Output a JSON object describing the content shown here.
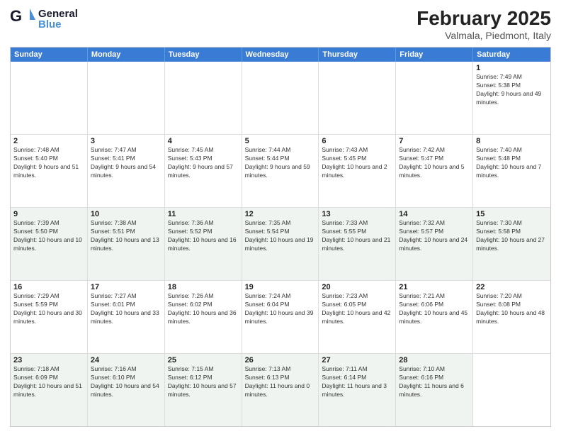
{
  "header": {
    "logo_line1": "General",
    "logo_line2": "Blue",
    "month_title": "February 2025",
    "subtitle": "Valmala, Piedmont, Italy"
  },
  "calendar": {
    "days_of_week": [
      "Sunday",
      "Monday",
      "Tuesday",
      "Wednesday",
      "Thursday",
      "Friday",
      "Saturday"
    ],
    "rows": [
      [
        {
          "day": "",
          "info": ""
        },
        {
          "day": "",
          "info": ""
        },
        {
          "day": "",
          "info": ""
        },
        {
          "day": "",
          "info": ""
        },
        {
          "day": "",
          "info": ""
        },
        {
          "day": "",
          "info": ""
        },
        {
          "day": "1",
          "info": "Sunrise: 7:49 AM\nSunset: 5:38 PM\nDaylight: 9 hours and 49 minutes."
        }
      ],
      [
        {
          "day": "2",
          "info": "Sunrise: 7:48 AM\nSunset: 5:40 PM\nDaylight: 9 hours and 51 minutes."
        },
        {
          "day": "3",
          "info": "Sunrise: 7:47 AM\nSunset: 5:41 PM\nDaylight: 9 hours and 54 minutes."
        },
        {
          "day": "4",
          "info": "Sunrise: 7:45 AM\nSunset: 5:43 PM\nDaylight: 9 hours and 57 minutes."
        },
        {
          "day": "5",
          "info": "Sunrise: 7:44 AM\nSunset: 5:44 PM\nDaylight: 9 hours and 59 minutes."
        },
        {
          "day": "6",
          "info": "Sunrise: 7:43 AM\nSunset: 5:45 PM\nDaylight: 10 hours and 2 minutes."
        },
        {
          "day": "7",
          "info": "Sunrise: 7:42 AM\nSunset: 5:47 PM\nDaylight: 10 hours and 5 minutes."
        },
        {
          "day": "8",
          "info": "Sunrise: 7:40 AM\nSunset: 5:48 PM\nDaylight: 10 hours and 7 minutes."
        }
      ],
      [
        {
          "day": "9",
          "info": "Sunrise: 7:39 AM\nSunset: 5:50 PM\nDaylight: 10 hours and 10 minutes."
        },
        {
          "day": "10",
          "info": "Sunrise: 7:38 AM\nSunset: 5:51 PM\nDaylight: 10 hours and 13 minutes."
        },
        {
          "day": "11",
          "info": "Sunrise: 7:36 AM\nSunset: 5:52 PM\nDaylight: 10 hours and 16 minutes."
        },
        {
          "day": "12",
          "info": "Sunrise: 7:35 AM\nSunset: 5:54 PM\nDaylight: 10 hours and 19 minutes."
        },
        {
          "day": "13",
          "info": "Sunrise: 7:33 AM\nSunset: 5:55 PM\nDaylight: 10 hours and 21 minutes."
        },
        {
          "day": "14",
          "info": "Sunrise: 7:32 AM\nSunset: 5:57 PM\nDaylight: 10 hours and 24 minutes."
        },
        {
          "day": "15",
          "info": "Sunrise: 7:30 AM\nSunset: 5:58 PM\nDaylight: 10 hours and 27 minutes."
        }
      ],
      [
        {
          "day": "16",
          "info": "Sunrise: 7:29 AM\nSunset: 5:59 PM\nDaylight: 10 hours and 30 minutes."
        },
        {
          "day": "17",
          "info": "Sunrise: 7:27 AM\nSunset: 6:01 PM\nDaylight: 10 hours and 33 minutes."
        },
        {
          "day": "18",
          "info": "Sunrise: 7:26 AM\nSunset: 6:02 PM\nDaylight: 10 hours and 36 minutes."
        },
        {
          "day": "19",
          "info": "Sunrise: 7:24 AM\nSunset: 6:04 PM\nDaylight: 10 hours and 39 minutes."
        },
        {
          "day": "20",
          "info": "Sunrise: 7:23 AM\nSunset: 6:05 PM\nDaylight: 10 hours and 42 minutes."
        },
        {
          "day": "21",
          "info": "Sunrise: 7:21 AM\nSunset: 6:06 PM\nDaylight: 10 hours and 45 minutes."
        },
        {
          "day": "22",
          "info": "Sunrise: 7:20 AM\nSunset: 6:08 PM\nDaylight: 10 hours and 48 minutes."
        }
      ],
      [
        {
          "day": "23",
          "info": "Sunrise: 7:18 AM\nSunset: 6:09 PM\nDaylight: 10 hours and 51 minutes."
        },
        {
          "day": "24",
          "info": "Sunrise: 7:16 AM\nSunset: 6:10 PM\nDaylight: 10 hours and 54 minutes."
        },
        {
          "day": "25",
          "info": "Sunrise: 7:15 AM\nSunset: 6:12 PM\nDaylight: 10 hours and 57 minutes."
        },
        {
          "day": "26",
          "info": "Sunrise: 7:13 AM\nSunset: 6:13 PM\nDaylight: 11 hours and 0 minutes."
        },
        {
          "day": "27",
          "info": "Sunrise: 7:11 AM\nSunset: 6:14 PM\nDaylight: 11 hours and 3 minutes."
        },
        {
          "day": "28",
          "info": "Sunrise: 7:10 AM\nSunset: 6:16 PM\nDaylight: 11 hours and 6 minutes."
        },
        {
          "day": "",
          "info": ""
        }
      ]
    ]
  }
}
